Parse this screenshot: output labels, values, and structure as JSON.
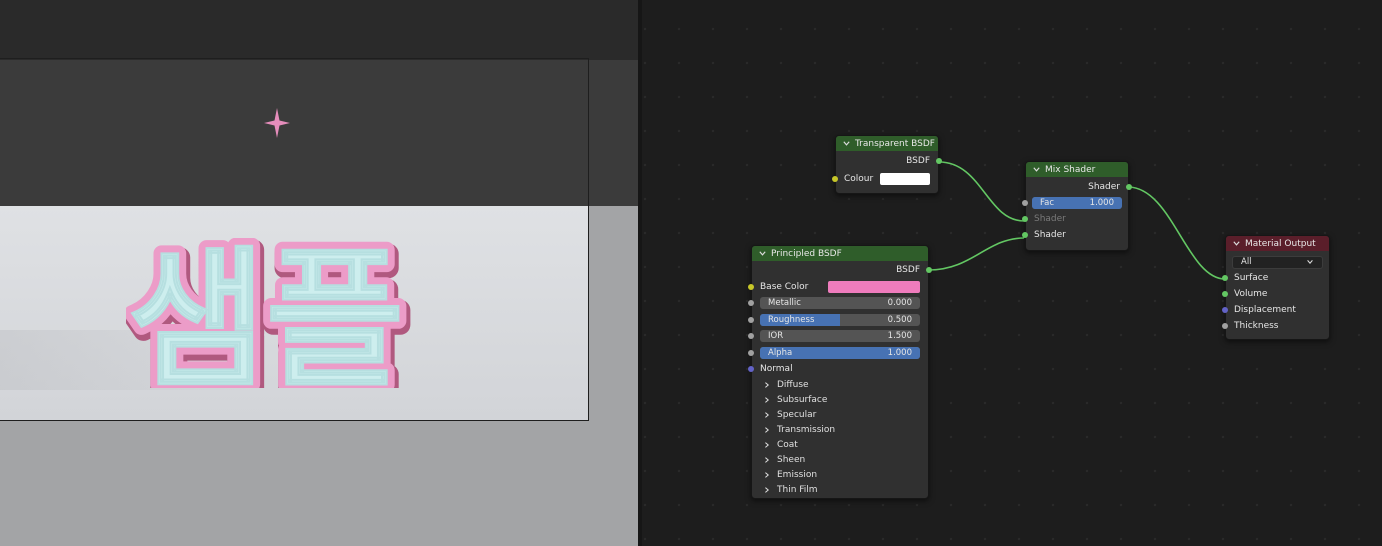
{
  "colors": {
    "shader_header": "#2f5d2a",
    "output_header": "#5a1e2a",
    "wire": "#63c763",
    "field_fill": "#4772b3",
    "base_color": "#ef7cbd",
    "text_pink": "#ec9cc8",
    "text_mint": "#cdeeee"
  },
  "viewport": {
    "text": "샘플",
    "light_icon": "light-star-icon"
  },
  "nodes": {
    "transparent": {
      "title": "Transparent BSDF",
      "output": "BSDF",
      "colour_label": "Colour",
      "colour_value": "#ffffff"
    },
    "mix": {
      "title": "Mix Shader",
      "output": "Shader",
      "fac_label": "Fac",
      "fac_value": "1.000",
      "fac_fraction": 1.0,
      "shader_in1": "Shader",
      "shader_in2": "Shader"
    },
    "principled": {
      "title": "Principled BSDF",
      "output": "BSDF",
      "base_color_label": "Base Color",
      "fields": [
        {
          "label": "Metallic",
          "value": "0.000",
          "fraction": 0.0
        },
        {
          "label": "Roughness",
          "value": "0.500",
          "fraction": 0.5
        },
        {
          "label": "IOR",
          "value": "1.500",
          "fraction": 0.0
        },
        {
          "label": "Alpha",
          "value": "1.000",
          "fraction": 1.0
        }
      ],
      "normal_label": "Normal",
      "panels": [
        "Diffuse",
        "Subsurface",
        "Specular",
        "Transmission",
        "Coat",
        "Sheen",
        "Emission",
        "Thin Film"
      ]
    },
    "output": {
      "title": "Material Output",
      "target": "All",
      "inputs": [
        "Surface",
        "Volume",
        "Displacement",
        "Thickness"
      ]
    }
  }
}
